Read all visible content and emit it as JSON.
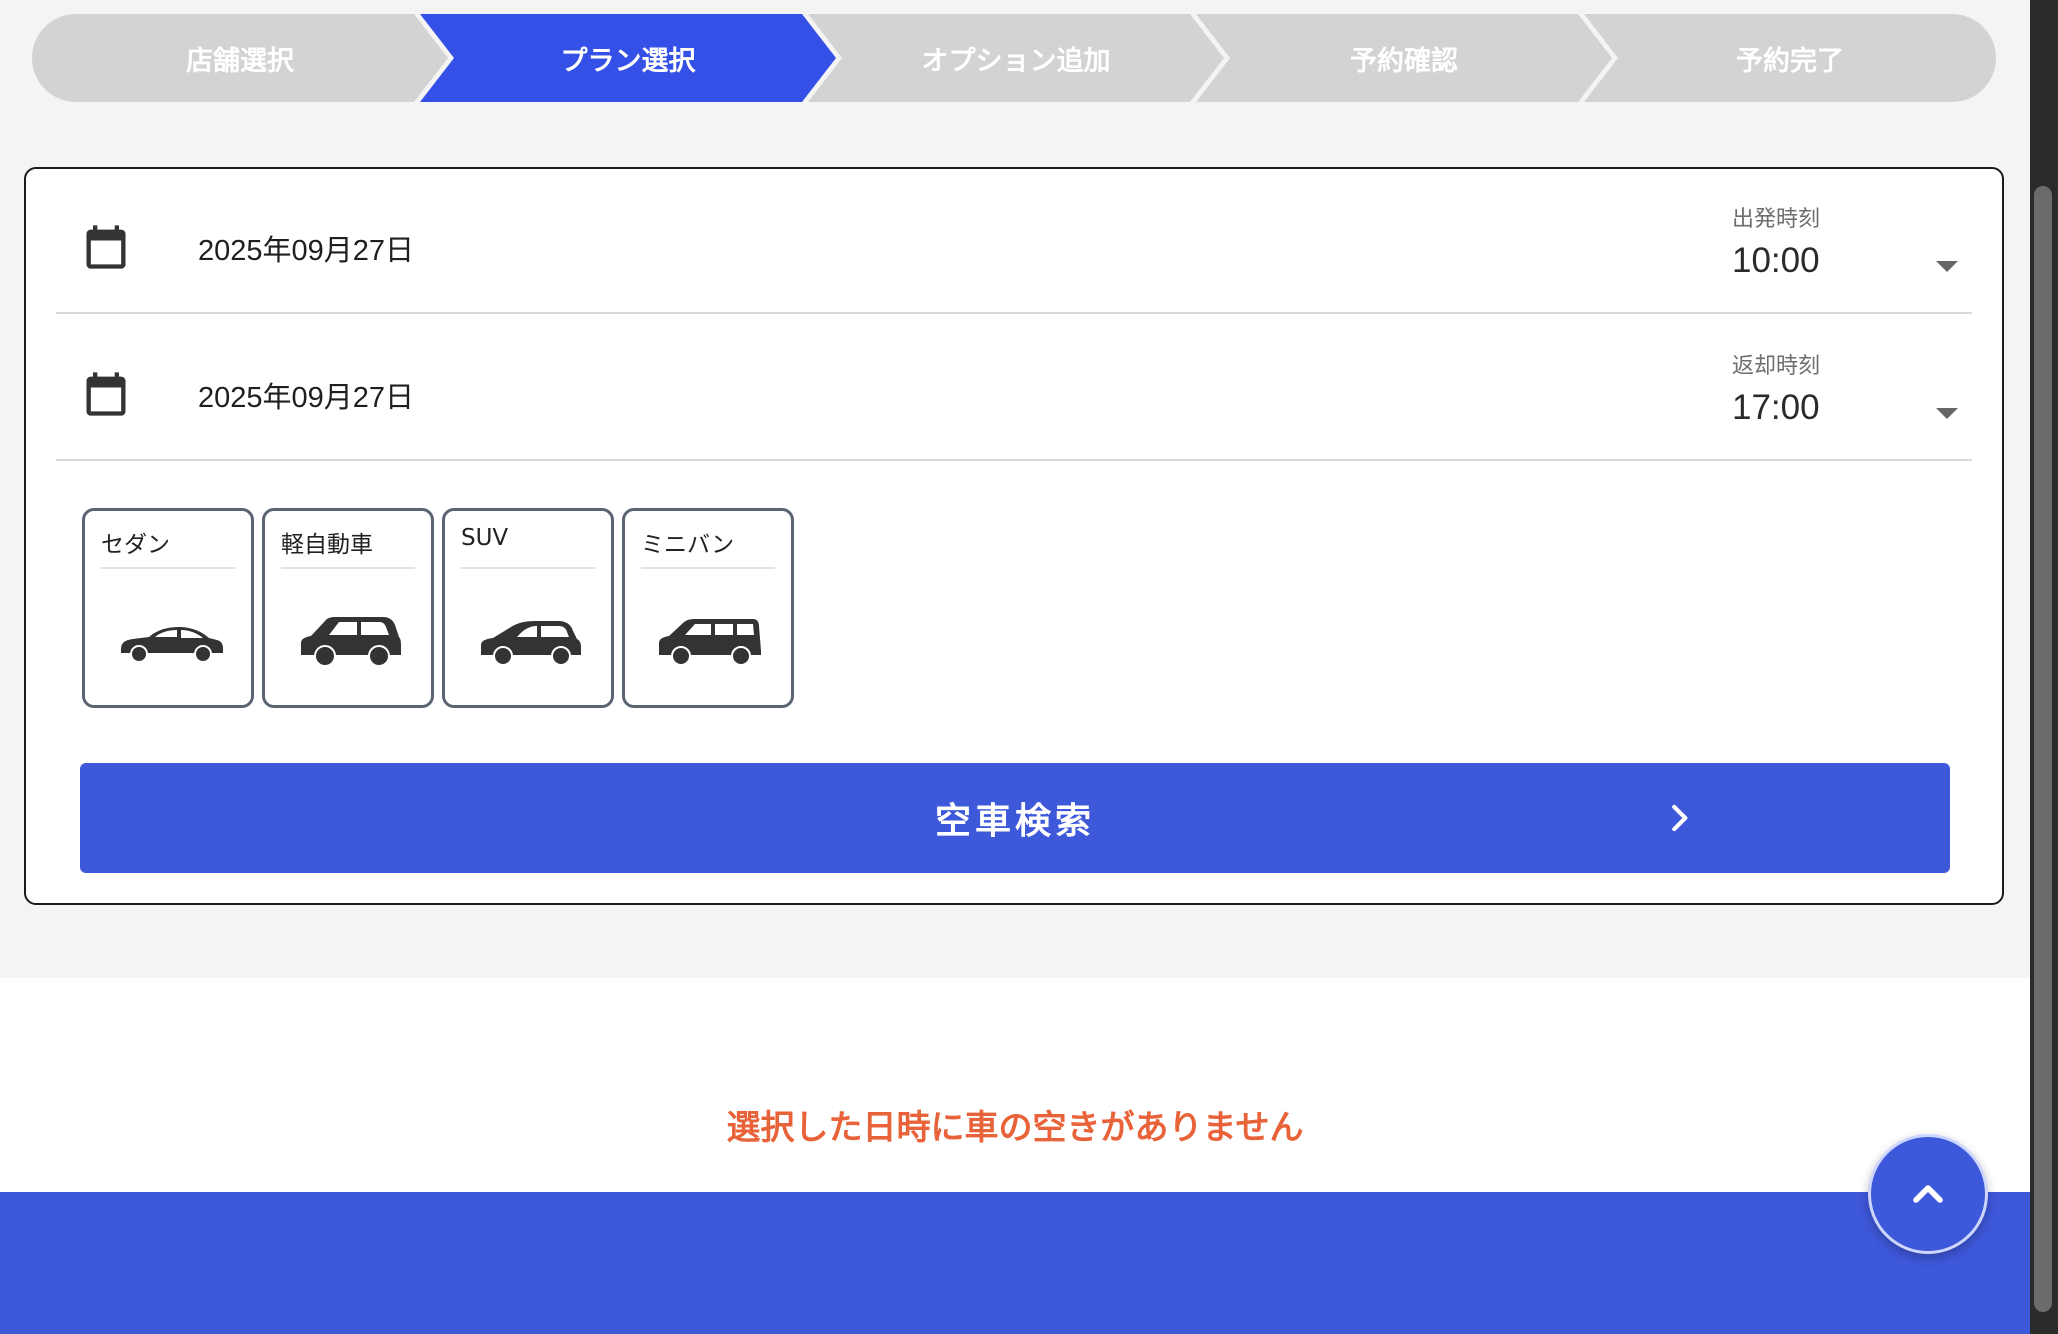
{
  "stepper": {
    "steps": [
      {
        "label": "店舗選択",
        "active": false
      },
      {
        "label": "プラン選択",
        "active": true
      },
      {
        "label": "オプション追加",
        "active": false
      },
      {
        "label": "予約確認",
        "active": false
      },
      {
        "label": "予約完了",
        "active": false
      }
    ]
  },
  "departure": {
    "date": "2025年09月27日",
    "time_label": "出発時刻",
    "time_value": "10:00",
    "icon": "calendar-icon"
  },
  "return": {
    "date": "2025年09月27日",
    "time_label": "返却時刻",
    "time_value": "17:00",
    "icon": "calendar-icon"
  },
  "car_types": [
    {
      "label": "セダン",
      "icon": "sedan-car-icon"
    },
    {
      "label": "軽自動車",
      "icon": "kei-car-icon"
    },
    {
      "label": "SUV",
      "icon": "suv-car-icon"
    },
    {
      "label": "ミニバン",
      "icon": "minivan-car-icon"
    }
  ],
  "search_button": {
    "label": "空車検索",
    "icon": "chevron-right-icon"
  },
  "message": "選択した日時に車の空きがありません",
  "scroll_top": {
    "icon": "chevron-up-icon"
  },
  "colors": {
    "primary": "#3e58da",
    "step_active": "#3550e6",
    "step_inactive": "#d3d3d3",
    "error_text": "#e8633a"
  }
}
